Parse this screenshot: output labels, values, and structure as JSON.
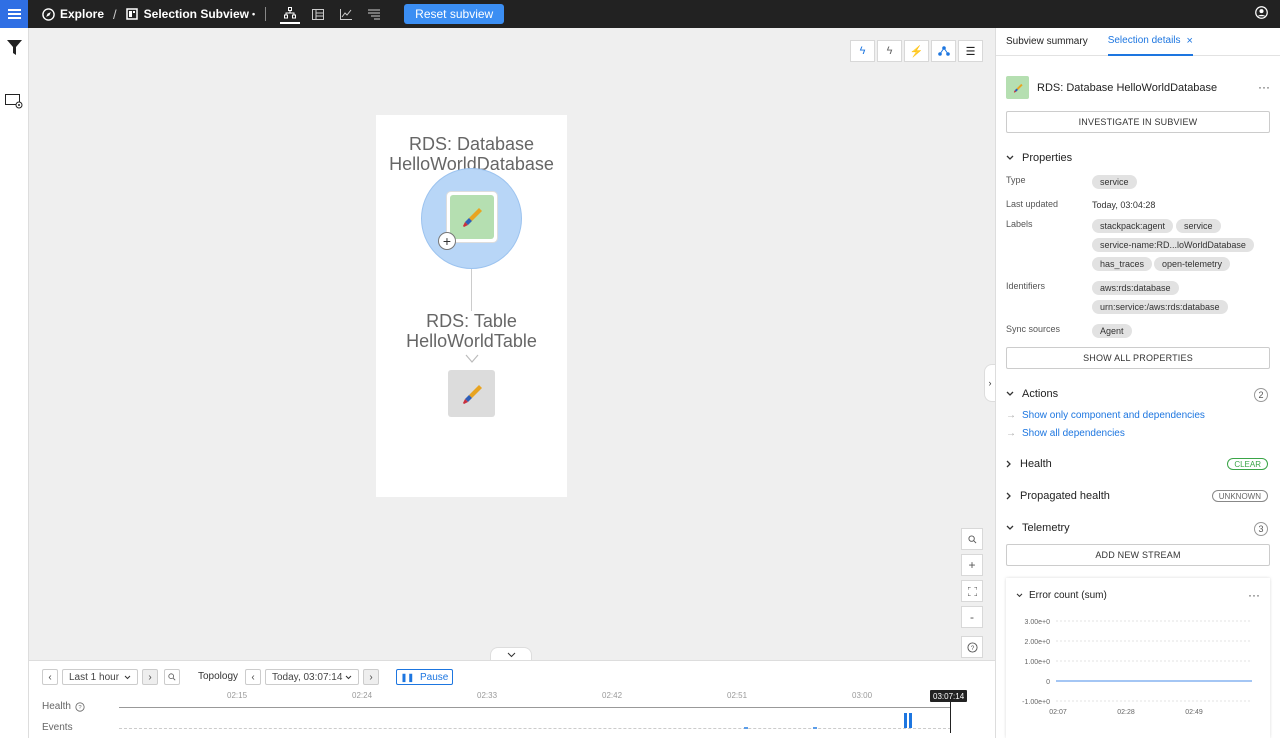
{
  "topbar": {
    "explore_label": "Explore",
    "separator": "/",
    "subview_label": "Selection Subview",
    "subview_modified_dot": "•",
    "reset_label": "Reset subview",
    "icons": [
      "topology-icon",
      "components-table-icon",
      "metrics-chart-icon",
      "events-list-icon"
    ]
  },
  "canvas": {
    "node1_title": "RDS: Database HelloWorldDatabase",
    "node2_title": "RDS: Table HelloWorldTable",
    "node_colors": {
      "selected_halo": "#b8d6f7",
      "healthy": "#b5dfb1",
      "unknown": "#dcdcdc"
    },
    "view_buttons": [
      "indirect-dependencies-icon",
      "direct-dependencies-icon",
      "dependencies-icon",
      "root-cause-icon",
      "list-icon"
    ],
    "zoom_buttons": {
      "search": "search-icon",
      "zoom_in": "+",
      "fit": "fit-icon",
      "zoom_out": "-",
      "help": "?"
    }
  },
  "timeline": {
    "range_label": "Last 1 hour",
    "topology_label": "Topology",
    "time_label": "Today, 03:07:14",
    "pause_label": "Pause",
    "health_label": "Health",
    "events_label": "Events",
    "ticks": [
      "02:15",
      "02:24",
      "02:33",
      "02:42",
      "02:51",
      "03:00"
    ],
    "current_time": "03:07:14"
  },
  "panel": {
    "tab_summary": "Subview summary",
    "tab_details": "Selection details",
    "tab_close": "×",
    "component_name": "RDS: Database HelloWorldDatabase",
    "more": "···",
    "investigate_label": "INVESTIGATE IN SUBVIEW",
    "properties_label": "Properties",
    "type_label": "Type",
    "type_value": "service",
    "last_updated_label": "Last updated",
    "last_updated_value": "Today, 03:04:28",
    "labels_label": "Labels",
    "labels": [
      "stackpack:agent",
      "service",
      "service-name:RD...loWorldDatabase",
      "has_traces",
      "open-telemetry"
    ],
    "identifiers_label": "Identifiers",
    "identifiers": [
      "aws:rds:database",
      "urn:service:/aws:rds:database"
    ],
    "sync_label": "Sync sources",
    "sync_value": "Agent",
    "show_all_props": "SHOW ALL PROPERTIES",
    "actions_label": "Actions",
    "actions_count": "2",
    "action1": "Show only component and dependencies",
    "action2": "Show all dependencies",
    "health_label": "Health",
    "health_badge": "CLEAR",
    "prop_health_label": "Propagated health",
    "prop_health_badge": "UNKNOWN",
    "telemetry_label": "Telemetry",
    "telemetry_count": "3",
    "add_stream": "ADD NEW STREAM",
    "chart_title": "Error count (sum)"
  },
  "chart_data": {
    "type": "line",
    "title": "Error count (sum)",
    "y_ticks": [
      "3.00e+0",
      "2.00e+0",
      "1.00e+0",
      "0",
      "-1.00e+0"
    ],
    "x_ticks": [
      "02:07",
      "02:28",
      "02:49"
    ],
    "ylim": [
      -1,
      3
    ],
    "series": [
      {
        "values": [
          0,
          0
        ]
      }
    ]
  }
}
